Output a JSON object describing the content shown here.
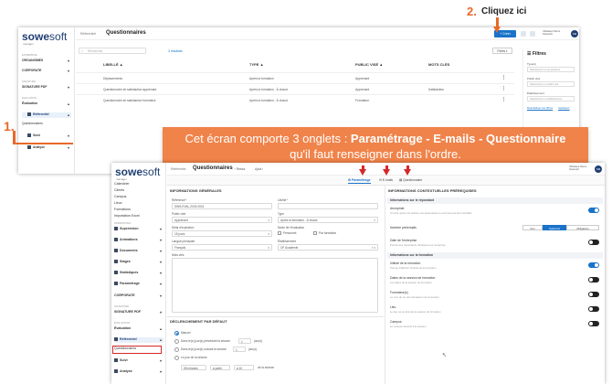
{
  "annotations": {
    "step2_number": "2.",
    "step2_text": "Cliquez ici",
    "step1_number": "1.",
    "banner_prefix": "Cet écran comporte 3 onglets : ",
    "banner_bold": "Paramétrage - E-mails - Questionnaire",
    "banner_line2": "qu'il faut renseigner dans l'ordre.",
    "accent_color": "#e8692b",
    "banner_color": "#f0834a",
    "arrow_color": "#d62828"
  },
  "app": {
    "logo_main": "sowe",
    "logo_soft": "soft",
    "logo_sub": "manager",
    "brand_color": "#1f3f73",
    "primary_color": "#1a73c9"
  },
  "list_view": {
    "breadcrumb": "Référentiel",
    "title": "Questionnaires",
    "add_button": "+ Créer",
    "user_name": "Utilisateur Démo",
    "user_company": "Sowesoft",
    "avatar": "SM",
    "search_placeholder": "Rechercher",
    "count": "3 résultats",
    "filter_button": "Filtres",
    "sidebar": [
      {
        "section": "Entreprise"
      },
      {
        "label": "ORGANISMES"
      },
      {
        "label": "CORPORATE"
      },
      {
        "section": "Signature"
      },
      {
        "label": "SIGNATURE PDF"
      },
      {
        "section": "Évaluation"
      },
      {
        "label": "Évaluation"
      },
      {
        "label": "Référentiel"
      },
      {
        "label": "Questionnaires"
      },
      {
        "label": "Suivi"
      },
      {
        "label": "Analyse"
      }
    ],
    "columns": [
      "LIBELLÉ",
      "TYPE",
      "PUBLIC VISÉ",
      "MOTS CLÉS"
    ],
    "rows": [
      {
        "label": "Déplacements",
        "type": "Après la formation",
        "public": "Apprenant",
        "keywords": ""
      },
      {
        "label": "Questionnaire de satisfaction apprenant",
        "type": "Après la formation - À chaud",
        "public": "Apprenant",
        "keywords": "Satisfaction"
      },
      {
        "label": "Questionnaire de satisfaction formateur",
        "type": "Après la formation - À chaud",
        "public": "Formateur",
        "keywords": ""
      }
    ],
    "filters": {
      "title": "Filtres",
      "type_label": "Type(s)",
      "type_placeholder": "Sélectionnez un ou plusieurs",
      "public_label": "Public visé",
      "public_placeholder": "Sélectionnez un public visé",
      "etab_label": "Établissement",
      "etab_placeholder": "Sélectionnez un établissement",
      "reset": "Réinitialiser les filtres",
      "apply": "Appliquer"
    }
  },
  "edit_view": {
    "breadcrumb": "Référentiel",
    "title": "Questionnaires",
    "mini_retour": "Retour",
    "mini_ajout": "Ajout",
    "user_name": "Utilisateur Démo",
    "user_company": "Sowesoft",
    "avatar": "SM",
    "tabs": [
      "Paramétrage",
      "E-mails",
      "Questionnaire"
    ],
    "sidebar": [
      "Calendrier",
      "Clients",
      "Campus",
      "Lieux",
      "Formations",
      "Importation Excel",
      "Supervision",
      "Animations",
      "Documents",
      "Stages",
      "Statistiques",
      "Paramétrage",
      "CORPORATE",
      "SIGNATURE PDF",
      "Évaluation",
      "Référentiel",
      "Questionnaires",
      "Suivi",
      "Analyse"
    ],
    "sidebar_sections": [
      "Opérations",
      "Signature",
      "Évaluation"
    ],
    "general": {
      "title": "INFORMATIONS GÉNÉRALES",
      "ref_label": "Référence*",
      "ref_value": "SWS-EVAL-2024-0001",
      "libelle_label": "Libellé *",
      "public_label": "Public visé",
      "public_value": "Apprenant",
      "type_label": "Type",
      "type_value": "Après la formation - À chaud",
      "delai_label": "Délai d'expiration",
      "delai_value": "15 jours",
      "mode_label": "Mode de l'évaluation",
      "mode_perso": "Personnel",
      "mode_unique": "Par formation",
      "langue_label": "Langue principale",
      "langue_value": "Français",
      "etab_label": "Établissement",
      "etab_value": "OF Académie",
      "motscles_label": "Mots clés"
    },
    "trigger": {
      "title": "DÉCLENCHEMENT PAR DÉFAUT",
      "opt1": "Manuel",
      "opt2": "Dans le(s) jour(s) précédant la séance",
      "opt3": "Dans le(s) jour(s) suivant la séance",
      "opt4": "Le jour de la séance",
      "val_jours": "1",
      "unit": "jour(s)",
      "time_start": "08 minutes",
      "time_a": "à partir",
      "time_end": "à 10",
      "time_suffix": "de la séance"
    },
    "context": {
      "title": "INFORMATIONS CONTEXTUELLES PRÉREQUISES",
      "group1": "Informations sur le répondant",
      "anonymat": "Anonymat",
      "anonymat_desc": "Si cette option est activée, les apprenants ne pourront pas être identifiés",
      "nombre_label": "Nombre préremplis",
      "seg_non": "Non",
      "seg_optionnel": "Optionnel",
      "seg_obligatoire": "Obligatoire",
      "date_label": "Date de l'entreprise",
      "date_desc": "Permet aux répondants d'indiquer leur entreprise",
      "group2": "Informations sur la formation",
      "intitule": "Intitulé de la formation",
      "intitule_desc": "Permet d'afficher l'intitulé de la formation",
      "dates": "Dates de la session de formation",
      "dates_desc": "Les dates de la session de formation",
      "formateur": "Formateur(s)",
      "formateur_desc": "Le nom du ou des formateurs de la session",
      "lieu": "Lieu",
      "lieu_desc": "Le lieu où se déroule la session de formation",
      "campus": "Campus",
      "campus_desc": "Le campus associé à la session"
    }
  }
}
